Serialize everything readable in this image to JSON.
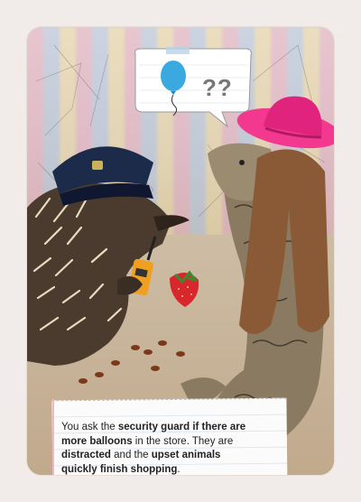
{
  "caption": {
    "segments": [
      {
        "text": "You ask the ",
        "bold": false
      },
      {
        "text": "security guard if there are more balloons",
        "bold": true
      },
      {
        "text": " in  the store. They are ",
        "bold": false
      },
      {
        "text": "distracted",
        "bold": true
      },
      {
        "text": " and the ",
        "bold": false
      },
      {
        "text": "upset animals quickly finish shopping",
        "bold": true
      },
      {
        "text": ".",
        "bold": false
      }
    ]
  },
  "speech_bubble": {
    "icon": "balloon-icon",
    "text": "??"
  },
  "colors": {
    "balloon": "#3aa9e0",
    "hat_pink": "#f2388f",
    "guard_cap": "#1d2b4a",
    "walkie": "#f0a020",
    "strawberry": "#d8262c",
    "note_stripe": "#f2a9b4"
  }
}
